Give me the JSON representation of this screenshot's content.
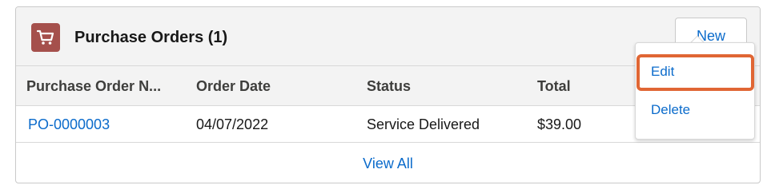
{
  "card": {
    "title": "Purchase Orders",
    "count": "(1)",
    "icon": "cart-icon",
    "icon_color": "#a5504c",
    "new_button": "New"
  },
  "table": {
    "columns": [
      "Purchase Order N...",
      "Order Date",
      "Status",
      "Total"
    ],
    "rows": [
      {
        "po_number": "PO-0000003",
        "order_date": "04/07/2022",
        "status": "Service Delivered",
        "total": "$39.00"
      }
    ]
  },
  "view_all": "View All",
  "menu": {
    "items": [
      "Edit",
      "Delete"
    ],
    "highlighted": "Edit",
    "highlight_color": "#e06634"
  },
  "colors": {
    "link": "#0b6bcb",
    "header_bg": "#f3f3f3"
  }
}
